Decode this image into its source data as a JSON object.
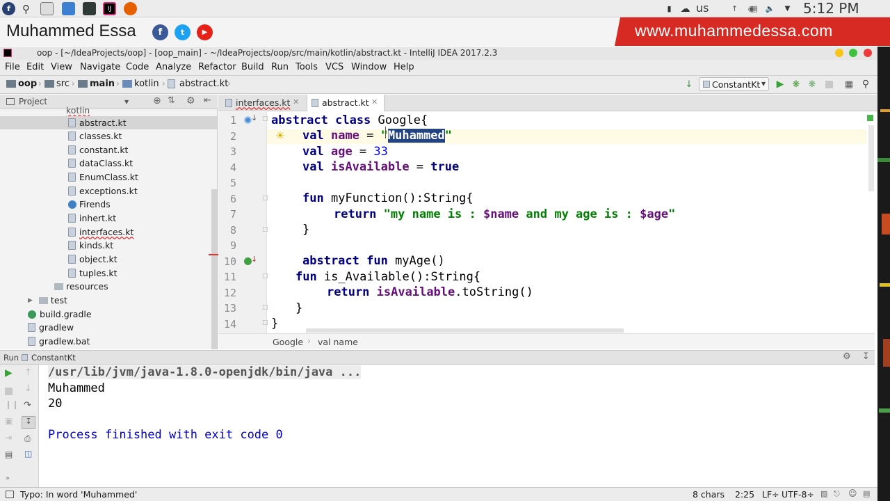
{
  "os_panel": {
    "keyboard_layout": "us",
    "clock": "5:12 PM"
  },
  "banner": {
    "name": "Muhammed Essa",
    "website": "www.muhammedessa.com"
  },
  "window": {
    "title": "oop - [~/IdeaProjects/oop] - [oop_main] - ~/IdeaProjects/oop/src/main/kotlin/abstract.kt - IntelliJ IDEA 2017.2.3"
  },
  "menu": [
    "File",
    "Edit",
    "View",
    "Navigate",
    "Code",
    "Analyze",
    "Refactor",
    "Build",
    "Run",
    "Tools",
    "VCS",
    "Window",
    "Help"
  ],
  "navbar": {
    "crumbs": [
      "oop",
      "src",
      "main",
      "kotlin",
      "abstract.kt"
    ],
    "run_config": "ConstantKt"
  },
  "project_panel": {
    "title": "Project",
    "partial_folder": "kotlin",
    "files": [
      "abstract.kt",
      "classes.kt",
      "constant.kt",
      "dataClass.kt",
      "EnumClass.kt",
      "exceptions.kt",
      "Firends",
      "inhert.kt",
      "interfaces.kt",
      "kinds.kt",
      "object.kt",
      "tuples.kt"
    ],
    "resources": "resources",
    "test": "test",
    "root_files": [
      "build.gradle",
      "gradlew",
      "gradlew.bat"
    ]
  },
  "tabs": [
    {
      "label": "interfaces.kt",
      "active": false
    },
    {
      "label": "abstract.kt",
      "active": true
    }
  ],
  "editor": {
    "line_numbers": [
      "1",
      "2",
      "3",
      "4",
      "5",
      "6",
      "7",
      "8",
      "9",
      "10",
      "11",
      "12",
      "13",
      "14"
    ],
    "l1_kw": "abstract class",
    "l1_rest": " Google{",
    "l2_kw": "val",
    "l2_prop": "name",
    "l2_eq": " = ",
    "l2_q": "\"",
    "l2_sel": "Muhammed",
    "l3_kw": "val",
    "l3_prop": "age",
    "l3_eq": " = ",
    "l3_num": "33",
    "l4_kw": "val",
    "l4_prop": "isAvailable",
    "l4_eq": " = ",
    "l4_val": "true",
    "l6_kw": "fun",
    "l6_rest": " myFunction():String{",
    "l7_kw": "return",
    "l7_s1": "\"my name is : ",
    "l7_t1": "$name",
    "l7_s2": " and my age is : ",
    "l7_t2": "$age",
    "l7_s3": "\"",
    "l8": "}",
    "l10_kw": "abstract fun",
    "l10_rest": " myAge()",
    "l11_kw": "fun",
    "l11_rest": " is_Available():String{",
    "l12_kw": "return",
    "l12_prop": "isAvailable",
    "l12_rest": ".toString()",
    "l13": "}",
    "l14": "}"
  },
  "editor_breadcrumb": [
    "Google",
    "val name"
  ],
  "run_panel": {
    "label": "Run",
    "config": "ConstantKt",
    "output": [
      "/usr/lib/jvm/java-1.8.0-openjdk/bin/java ...",
      "Muhammed",
      "20",
      "",
      "Process finished with exit code 0"
    ]
  },
  "status": {
    "message": "Typo: In word 'Muhammed'",
    "chars": "8 chars",
    "position": "2:25",
    "line_sep": "LF÷",
    "encoding": "UTF-8÷"
  },
  "colors": {
    "banner_red": "#d62a23",
    "keyword": "#000080",
    "string": "#008000",
    "selection": "#214283",
    "facebook": "#3b5998",
    "twitter": "#1da1f2",
    "youtube": "#e62117"
  }
}
